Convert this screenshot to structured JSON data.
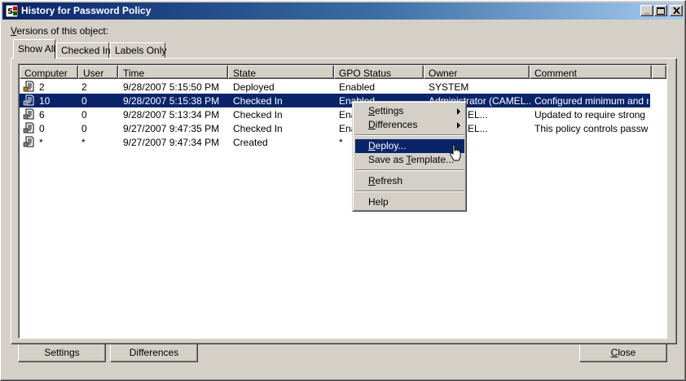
{
  "window": {
    "title": "History for Password Policy",
    "versions_label_u": "V",
    "versions_label_rest": "ersions of this object:"
  },
  "tabs": [
    {
      "label": "Show All",
      "active": true
    },
    {
      "label": "Checked In",
      "active": false
    },
    {
      "label": "Labels Only",
      "active": false
    }
  ],
  "table": {
    "columns": [
      "Computer",
      "User",
      "Time",
      "State",
      "GPO Status",
      "Owner",
      "Comment"
    ],
    "rows": [
      {
        "computer": "2",
        "user": "2",
        "time": "9/28/2007 5:15:50 PM",
        "state": "Deployed",
        "gpo_status": "Enabled",
        "owner": "SYSTEM",
        "comment": "",
        "selected": false,
        "icon": "deployed-document-icon"
      },
      {
        "computer": "10",
        "user": "0",
        "time": "9/28/2007 5:15:38 PM",
        "state": "Checked In",
        "gpo_status": "Enabled",
        "owner": "Administrator (CAMEL...",
        "comment": "Configured minimum and m...",
        "selected": true,
        "icon": "checked-in-document-icon"
      },
      {
        "computer": "6",
        "user": "0",
        "time": "9/28/2007 5:13:34 PM",
        "state": "Checked In",
        "gpo_status": "Ena",
        "owner": "tor (CAMEL...",
        "comment": "Updated to require strong p...",
        "selected": false,
        "icon": "checked-in-document-icon"
      },
      {
        "computer": "0",
        "user": "0",
        "time": "9/27/2007 9:47:35 PM",
        "state": "Checked In",
        "gpo_status": "Ena",
        "owner": "tor (CAMEL...",
        "comment": "This policy controls passwo...",
        "selected": false,
        "icon": "checked-in-document-icon"
      },
      {
        "computer": "*",
        "user": "*",
        "time": "9/27/2007 9:47:34 PM",
        "state": "Created",
        "gpo_status": "*",
        "owner": "",
        "comment": "",
        "selected": false,
        "icon": "created-document-icon"
      }
    ]
  },
  "context_menu": {
    "items": [
      {
        "u": "S",
        "rest": "ettings",
        "submenu": true,
        "highlighted": false
      },
      {
        "u": "D",
        "rest": "ifferences",
        "submenu": true,
        "highlighted": false
      },
      {
        "u": "D",
        "rest": "eploy...",
        "submenu": false,
        "highlighted": true
      },
      {
        "pre": "Save as ",
        "u": "T",
        "rest": "emplate...",
        "submenu": false,
        "highlighted": false
      },
      {
        "u": "R",
        "rest": "efresh",
        "submenu": false,
        "highlighted": false
      },
      {
        "u": "",
        "rest": "Help",
        "submenu": false,
        "highlighted": false
      }
    ]
  },
  "buttons": {
    "settings": "Settings",
    "differences": "Differences",
    "close_u": "C",
    "close_rest": "lose"
  },
  "colors": {
    "selection": "#0a246a",
    "face": "#d4d0c8"
  }
}
